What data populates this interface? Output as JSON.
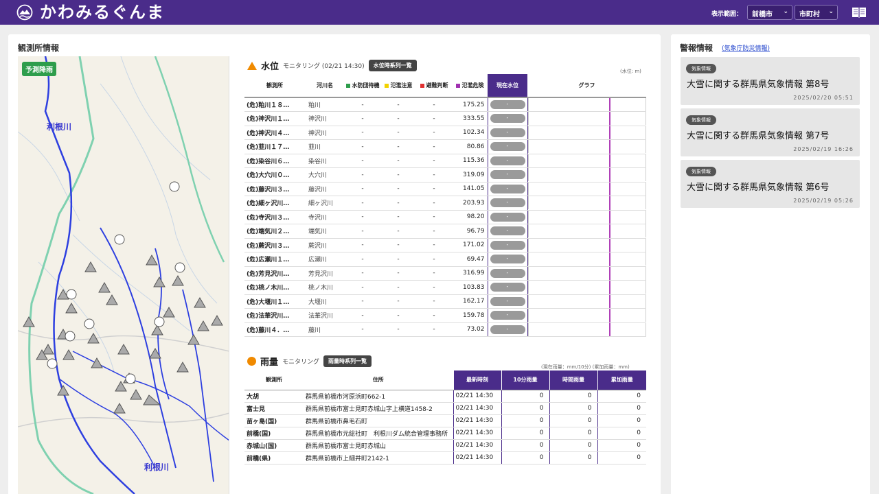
{
  "header": {
    "app_title": "かわみるぐんま",
    "display_range_label": "表示範囲：",
    "city_select": "前橋市",
    "municipality_select": "市町村"
  },
  "observation": {
    "panel_title": "観測所情報",
    "map": {
      "predict_button": "予測降雨",
      "river_label_top": "利根川",
      "river_label_bottom": "利根川"
    }
  },
  "water_level": {
    "title": "水位",
    "subtitle": "モニタリング (02/21 14:30)",
    "list_button": "水位時系列一覧",
    "unit": "(水位: m)",
    "headers": {
      "station": "観測所",
      "river": "河川名",
      "level1": "水防団待機",
      "level2": "氾濫注意",
      "level3": "避難判断",
      "level4": "氾濫危険",
      "current": "現在水位",
      "graph": "グラフ"
    },
    "legend_colors": [
      "#2e9d4c",
      "#f2d200",
      "#e03030",
      "#a030b0"
    ],
    "current_value": "-",
    "rows": [
      {
        "station": "(危)粕川１８…",
        "river": "粕川",
        "l1": "-",
        "l2": "-",
        "l3": "-",
        "l4": "175.25"
      },
      {
        "station": "(危)神沢川１…",
        "river": "神沢川",
        "l1": "-",
        "l2": "-",
        "l3": "-",
        "l4": "333.55"
      },
      {
        "station": "(危)神沢川４…",
        "river": "神沢川",
        "l1": "-",
        "l2": "-",
        "l3": "-",
        "l4": "102.34"
      },
      {
        "station": "(危)韮川１７…",
        "river": "韮川",
        "l1": "-",
        "l2": "-",
        "l3": "-",
        "l4": "80.86"
      },
      {
        "station": "(危)染谷川６…",
        "river": "染谷川",
        "l1": "-",
        "l2": "-",
        "l3": "-",
        "l4": "115.36"
      },
      {
        "station": "(危)大穴川０…",
        "river": "大穴川",
        "l1": "-",
        "l2": "-",
        "l3": "-",
        "l4": "319.09"
      },
      {
        "station": "(危)藤沢川３…",
        "river": "藤沢川",
        "l1": "-",
        "l2": "-",
        "l3": "-",
        "l4": "141.05"
      },
      {
        "station": "(危)細ヶ沢川…",
        "river": "細ヶ沢川",
        "l1": "-",
        "l2": "-",
        "l3": "-",
        "l4": "203.93"
      },
      {
        "station": "(危)寺沢川３…",
        "river": "寺沢川",
        "l1": "-",
        "l2": "-",
        "l3": "-",
        "l4": "98.20"
      },
      {
        "station": "(危)端気川２…",
        "river": "端気川",
        "l1": "-",
        "l2": "-",
        "l3": "-",
        "l4": "96.79"
      },
      {
        "station": "(危)蕨沢川３…",
        "river": "蕨沢川",
        "l1": "-",
        "l2": "-",
        "l3": "-",
        "l4": "171.02"
      },
      {
        "station": "(危)広瀬川１…",
        "river": "広瀬川",
        "l1": "-",
        "l2": "-",
        "l3": "-",
        "l4": "69.47"
      },
      {
        "station": "(危)芳見沢川…",
        "river": "芳見沢川",
        "l1": "-",
        "l2": "-",
        "l3": "-",
        "l4": "316.99"
      },
      {
        "station": "(危)桃ノ木川…",
        "river": "桃ノ木川",
        "l1": "-",
        "l2": "-",
        "l3": "-",
        "l4": "103.83"
      },
      {
        "station": "(危)大堰川１…",
        "river": "大堰川",
        "l1": "-",
        "l2": "-",
        "l3": "-",
        "l4": "162.17"
      },
      {
        "station": "(危)法華沢川…",
        "river": "法華沢川",
        "l1": "-",
        "l2": "-",
        "l3": "-",
        "l4": "159.78"
      },
      {
        "station": "(危)藤川４．…",
        "river": "藤川",
        "l1": "-",
        "l2": "-",
        "l3": "-",
        "l4": "73.02"
      }
    ]
  },
  "rainfall": {
    "title": "雨量",
    "subtitle": "モニタリング",
    "list_button": "雨量時系列一覧",
    "unit": "(現在雨量：mm/10分) (累加雨量：mm)",
    "headers": {
      "station": "観測所",
      "address": "住所",
      "time": "最新時刻",
      "r10": "10分雨量",
      "hourly": "時間雨量",
      "cumulative": "累加雨量"
    },
    "rows": [
      {
        "station": "大胡",
        "address": "群馬県前橋市河原浜町662-1",
        "time": "02/21 14:30",
        "r10": "0",
        "hourly": "0",
        "cumulative": "0"
      },
      {
        "station": "富士見",
        "address": "群馬県前橋市富士見町赤城山字上横道1458-2",
        "time": "02/21 14:30",
        "r10": "0",
        "hourly": "0",
        "cumulative": "0"
      },
      {
        "station": "苗ヶ島(国)",
        "address": "群馬県前橋市鼻毛石町",
        "time": "02/21 14:30",
        "r10": "0",
        "hourly": "0",
        "cumulative": "0"
      },
      {
        "station": "前橋(国)",
        "address": "群馬県前橋市元総社町　利根川ダム統合管理事務所",
        "time": "02/21 14:30",
        "r10": "0",
        "hourly": "0",
        "cumulative": "0"
      },
      {
        "station": "赤城山(国)",
        "address": "群馬県前橋市富士見町赤城山",
        "time": "02/21 14:30",
        "r10": "0",
        "hourly": "0",
        "cumulative": "0"
      },
      {
        "station": "前橋(県)",
        "address": "群馬県前橋市上細井町2142-1",
        "time": "02/21 14:30",
        "r10": "0",
        "hourly": "0",
        "cumulative": "0"
      }
    ]
  },
  "alerts": {
    "panel_title": "警報情報",
    "jma_link": "(気象庁防災情報)",
    "items": [
      {
        "tag": "気象情報",
        "title": "大雪に関する群馬県気象情報 第8号",
        "date": "2025/02/20 05:51"
      },
      {
        "tag": "気象情報",
        "title": "大雪に関する群馬県気象情報 第7号",
        "date": "2025/02/19 16:26"
      },
      {
        "tag": "気象情報",
        "title": "大雪に関する群馬県気象情報 第6号",
        "date": "2025/02/19 05:26"
      }
    ]
  },
  "colors": {
    "brand": "#4a2c8a",
    "warning_orange": "#f08a00",
    "predict_green": "#2e9d4c"
  }
}
